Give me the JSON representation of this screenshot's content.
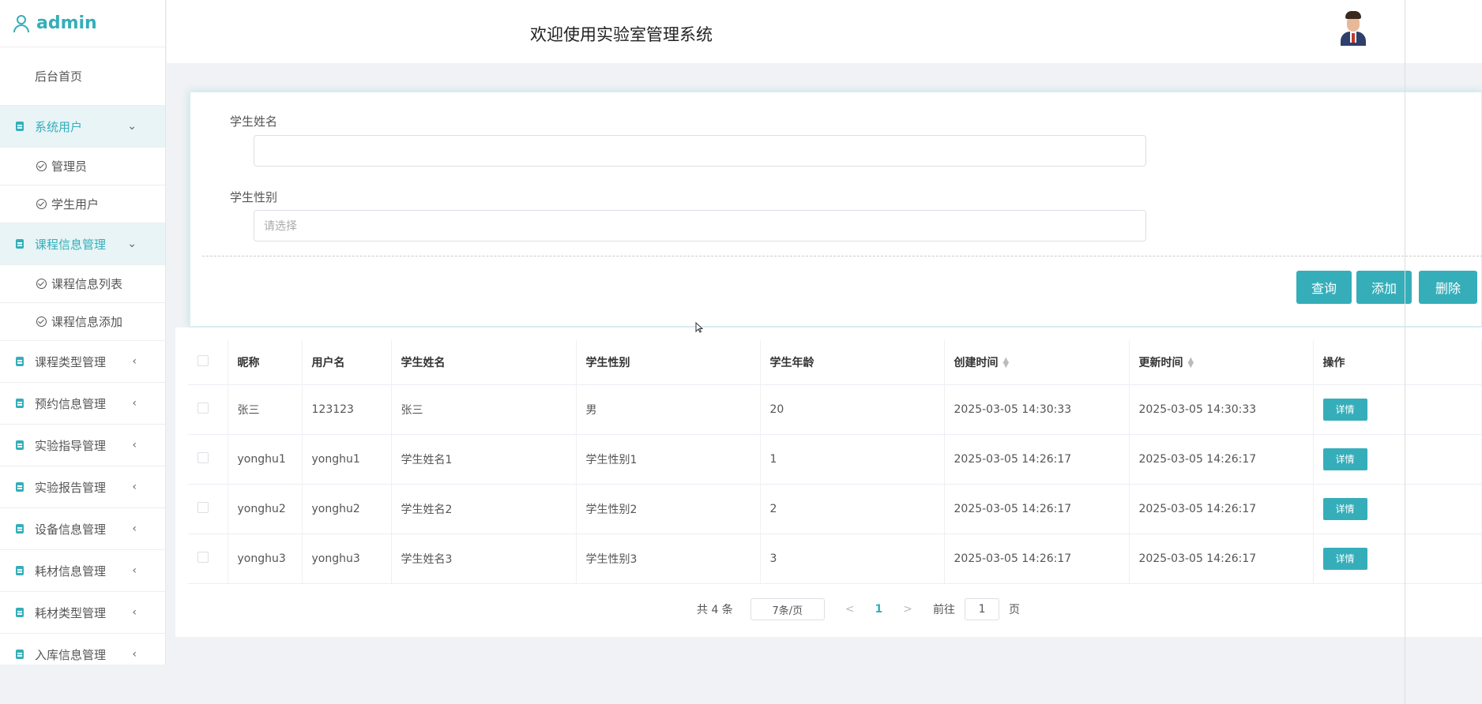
{
  "sidebar": {
    "username": "admin",
    "home": "后台首页",
    "groups": [
      {
        "label": "系统用户",
        "open": true,
        "children": [
          "管理员",
          "学生用户"
        ]
      },
      {
        "label": "课程信息管理",
        "open": true,
        "children": [
          "课程信息列表",
          "课程信息添加"
        ]
      },
      {
        "label": "课程类型管理",
        "open": false
      },
      {
        "label": "预约信息管理",
        "open": false
      },
      {
        "label": "实验指导管理",
        "open": false
      },
      {
        "label": "实验报告管理",
        "open": false
      },
      {
        "label": "设备信息管理",
        "open": false
      },
      {
        "label": "耗材信息管理",
        "open": false
      },
      {
        "label": "耗材类型管理",
        "open": false
      },
      {
        "label": "入库信息管理",
        "open": false
      }
    ]
  },
  "header": {
    "title": "欢迎使用实验室管理系统"
  },
  "search": {
    "name_label": "学生姓名",
    "name_value": "",
    "gender_label": "学生性别",
    "gender_placeholder": "请选择",
    "query_button": "查询",
    "add_button": "添加",
    "delete_button": "删除"
  },
  "table": {
    "columns": [
      "昵称",
      "用户名",
      "学生姓名",
      "学生性别",
      "学生年龄",
      "创建时间",
      "更新时间",
      "操作"
    ],
    "rows": [
      [
        "张三",
        "123123",
        "张三",
        "男",
        "20",
        "2025-03-05 14:30:33",
        "2025-03-05 14:30:33"
      ],
      [
        "yonghu1",
        "yonghu1",
        "学生姓名1",
        "学生性别1",
        "1",
        "2025-03-05 14:26:17",
        "2025-03-05 14:26:17"
      ],
      [
        "yonghu2",
        "yonghu2",
        "学生姓名2",
        "学生性别2",
        "2",
        "2025-03-05 14:26:17",
        "2025-03-05 14:26:17"
      ],
      [
        "yonghu3",
        "yonghu3",
        "学生姓名3",
        "学生性别3",
        "3",
        "2025-03-05 14:26:17",
        "2025-03-05 14:26:17"
      ]
    ],
    "detail_label": "详情"
  },
  "pager": {
    "total": "共 4 条",
    "page_size": "7条/页",
    "prev": "<",
    "current": "1",
    "next": ">",
    "goto_label": "前往",
    "goto_value": "1",
    "page_suffix": "页"
  },
  "colors": {
    "accent": "#35aeba"
  }
}
